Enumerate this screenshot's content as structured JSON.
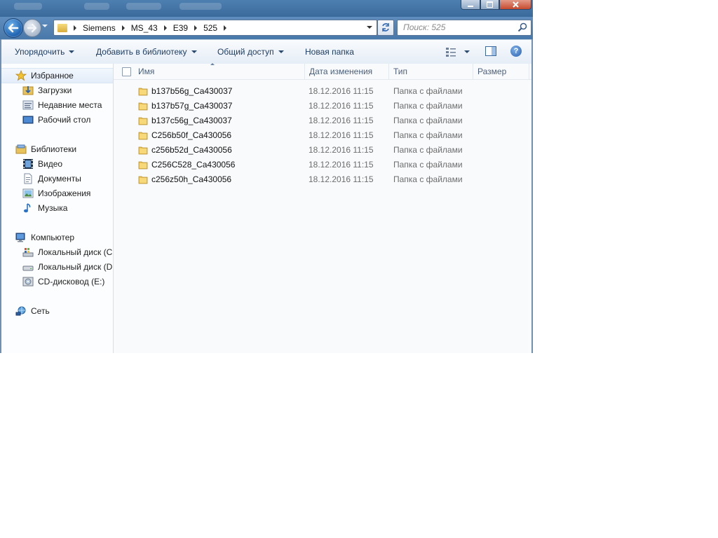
{
  "window": {
    "caption_buttons": {
      "minimize": "minimize-icon",
      "maximize": "maximize-icon",
      "close": "close-icon"
    }
  },
  "address_bar": {
    "path": [
      "Siemens",
      "MS_43",
      "E39",
      "525"
    ]
  },
  "search": {
    "placeholder": "Поиск: 525"
  },
  "toolbar": {
    "organize": "Упорядочить",
    "add_to_library": "Добавить в библиотеку",
    "share": "Общий доступ",
    "new_folder": "Новая папка"
  },
  "sidebar": {
    "favorites": {
      "label": "Избранное",
      "icon": "star-icon"
    },
    "favorites_items": [
      {
        "label": "Загрузки",
        "icon": "downloads-icon"
      },
      {
        "label": "Недавние места",
        "icon": "recent-places-icon"
      },
      {
        "label": "Рабочий стол",
        "icon": "desktop-icon"
      }
    ],
    "libraries": {
      "label": "Библиотеки",
      "icon": "library-icon"
    },
    "libraries_items": [
      {
        "label": "Видео",
        "icon": "video-icon"
      },
      {
        "label": "Документы",
        "icon": "documents-icon"
      },
      {
        "label": "Изображения",
        "icon": "pictures-icon"
      },
      {
        "label": "Музыка",
        "icon": "music-icon"
      }
    ],
    "computer": {
      "label": "Компьютер",
      "icon": "computer-icon"
    },
    "computer_items": [
      {
        "label": "Локальный диск (C",
        "icon": "drive-c-icon"
      },
      {
        "label": "Локальный диск (D",
        "icon": "drive-d-icon"
      },
      {
        "label": "CD-дисковод (E:)",
        "icon": "cd-drive-icon"
      }
    ],
    "network": {
      "label": "Сеть",
      "icon": "network-icon"
    }
  },
  "file_list": {
    "columns": {
      "name": "Имя",
      "date": "Дата изменения",
      "type": "Тип",
      "size": "Размер"
    },
    "rows": [
      {
        "name": "b137b56g_Ca430037",
        "date": "18.12.2016 11:15",
        "type": "Папка с файлами",
        "size": ""
      },
      {
        "name": "b137b57g_Ca430037",
        "date": "18.12.2016 11:15",
        "type": "Папка с файлами",
        "size": ""
      },
      {
        "name": "b137c56g_Ca430037",
        "date": "18.12.2016 11:15",
        "type": "Папка с файлами",
        "size": ""
      },
      {
        "name": "C256b50f_Ca430056",
        "date": "18.12.2016 11:15",
        "type": "Папка с файлами",
        "size": ""
      },
      {
        "name": "c256b52d_Ca430056",
        "date": "18.12.2016 11:15",
        "type": "Папка с файлами",
        "size": ""
      },
      {
        "name": "C256C528_Ca430056",
        "date": "18.12.2016 11:15",
        "type": "Папка с файлами",
        "size": ""
      },
      {
        "name": "c256z50h_Ca430056",
        "date": "18.12.2016 11:15",
        "type": "Папка с файлами",
        "size": ""
      }
    ]
  },
  "colors": {
    "accent": "#4878a9",
    "folder": "#e8c25a"
  }
}
